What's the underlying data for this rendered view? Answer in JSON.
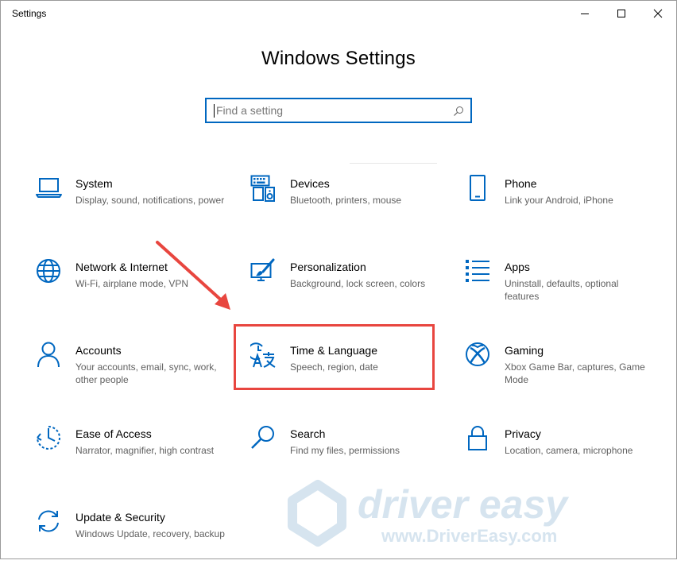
{
  "window": {
    "title": "Settings",
    "heading": "Windows Settings"
  },
  "search": {
    "placeholder": "Find a setting"
  },
  "colors": {
    "accent": "#0067c0",
    "highlight": "#e8463f",
    "watermark": "#d6e4ef"
  },
  "tiles": [
    {
      "title": "System",
      "desc": "Display, sound, notifications, power",
      "icon": "laptop-icon"
    },
    {
      "title": "Devices",
      "desc": "Bluetooth, printers, mouse",
      "icon": "keyboard-speaker-icon"
    },
    {
      "title": "Phone",
      "desc": "Link your Android, iPhone",
      "icon": "phone-icon"
    },
    {
      "title": "Network & Internet",
      "desc": "Wi-Fi, airplane mode, VPN",
      "icon": "globe-icon"
    },
    {
      "title": "Personalization",
      "desc": "Background, lock screen, colors",
      "icon": "paintbrush-icon"
    },
    {
      "title": "Apps",
      "desc": "Uninstall, defaults, optional features",
      "icon": "apps-list-icon"
    },
    {
      "title": "Accounts",
      "desc": "Your accounts, email, sync, work, other people",
      "icon": "person-icon"
    },
    {
      "title": "Time & Language",
      "desc": "Speech, region, date",
      "icon": "time-language-icon"
    },
    {
      "title": "Gaming",
      "desc": "Xbox Game Bar, captures, Game Mode",
      "icon": "xbox-icon"
    },
    {
      "title": "Ease of Access",
      "desc": "Narrator, magnifier, high contrast",
      "icon": "ease-of-access-icon"
    },
    {
      "title": "Search",
      "desc": "Find my files, permissions",
      "icon": "search-icon"
    },
    {
      "title": "Privacy",
      "desc": "Location, camera, microphone",
      "icon": "lock-icon"
    },
    {
      "title": "Update & Security",
      "desc": "Windows Update, recovery, backup",
      "icon": "sync-arrows-icon"
    }
  ],
  "watermark": {
    "brand": "driver easy",
    "url": "www.DriverEasy.com"
  }
}
